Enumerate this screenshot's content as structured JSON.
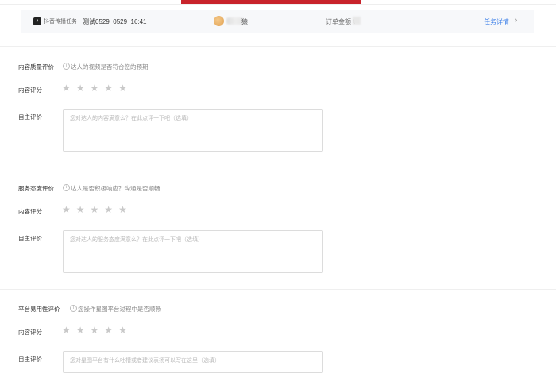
{
  "task": {
    "platform_label": "抖音传播任务",
    "task_name": "测试0529_0529_16:41",
    "influencer_suffix": "猿",
    "order_amount_label": "订单金额 ¥",
    "detail_link": "任务详情",
    "chevron_icon": "chevron-right-icon"
  },
  "sections": [
    {
      "title": "内容质量评价",
      "hint": "达人的视频是否符合您的预期",
      "rating_label": "内容评分",
      "rating_stars": 5,
      "rating_value": 0,
      "comment_label": "自主评价",
      "comment_placeholder": "您对达人的内容满意么？在此点评一下吧（选填）"
    },
    {
      "title": "服务态度评价",
      "hint": "达人是否积极响应？沟通是否顺畅",
      "rating_label": "内容评分",
      "rating_stars": 5,
      "rating_value": 0,
      "comment_label": "自主评价",
      "comment_placeholder": "您对达人的服务态度满意么？在此点评一下吧（选填）"
    },
    {
      "title": "平台易用性评价",
      "hint": "您操作星图平台过程中是否顺畅",
      "rating_label": "内容评分",
      "rating_stars": 5,
      "rating_value": 0,
      "comment_label": "自主评价",
      "comment_placeholder": "您对星图平台有什么吐槽或者建议表扬可以写在这里（选填）"
    }
  ],
  "colors": {
    "accent": "#c8232b",
    "link": "#3a7ee8",
    "star_empty": "#c9c9c9"
  }
}
